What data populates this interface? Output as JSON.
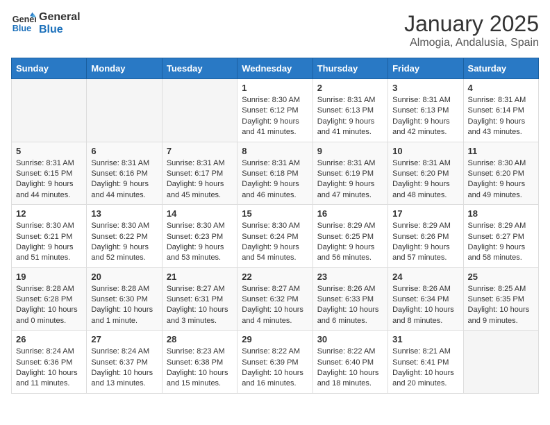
{
  "logo": {
    "line1": "General",
    "line2": "Blue"
  },
  "header": {
    "month": "January 2025",
    "location": "Almogia, Andalusia, Spain"
  },
  "weekdays": [
    "Sunday",
    "Monday",
    "Tuesday",
    "Wednesday",
    "Thursday",
    "Friday",
    "Saturday"
  ],
  "weeks": [
    [
      {
        "day": "",
        "info": ""
      },
      {
        "day": "",
        "info": ""
      },
      {
        "day": "",
        "info": ""
      },
      {
        "day": "1",
        "info": "Sunrise: 8:30 AM\nSunset: 6:12 PM\nDaylight: 9 hours and 41 minutes."
      },
      {
        "day": "2",
        "info": "Sunrise: 8:31 AM\nSunset: 6:13 PM\nDaylight: 9 hours and 41 minutes."
      },
      {
        "day": "3",
        "info": "Sunrise: 8:31 AM\nSunset: 6:13 PM\nDaylight: 9 hours and 42 minutes."
      },
      {
        "day": "4",
        "info": "Sunrise: 8:31 AM\nSunset: 6:14 PM\nDaylight: 9 hours and 43 minutes."
      }
    ],
    [
      {
        "day": "5",
        "info": "Sunrise: 8:31 AM\nSunset: 6:15 PM\nDaylight: 9 hours and 44 minutes."
      },
      {
        "day": "6",
        "info": "Sunrise: 8:31 AM\nSunset: 6:16 PM\nDaylight: 9 hours and 44 minutes."
      },
      {
        "day": "7",
        "info": "Sunrise: 8:31 AM\nSunset: 6:17 PM\nDaylight: 9 hours and 45 minutes."
      },
      {
        "day": "8",
        "info": "Sunrise: 8:31 AM\nSunset: 6:18 PM\nDaylight: 9 hours and 46 minutes."
      },
      {
        "day": "9",
        "info": "Sunrise: 8:31 AM\nSunset: 6:19 PM\nDaylight: 9 hours and 47 minutes."
      },
      {
        "day": "10",
        "info": "Sunrise: 8:31 AM\nSunset: 6:20 PM\nDaylight: 9 hours and 48 minutes."
      },
      {
        "day": "11",
        "info": "Sunrise: 8:30 AM\nSunset: 6:20 PM\nDaylight: 9 hours and 49 minutes."
      }
    ],
    [
      {
        "day": "12",
        "info": "Sunrise: 8:30 AM\nSunset: 6:21 PM\nDaylight: 9 hours and 51 minutes."
      },
      {
        "day": "13",
        "info": "Sunrise: 8:30 AM\nSunset: 6:22 PM\nDaylight: 9 hours and 52 minutes."
      },
      {
        "day": "14",
        "info": "Sunrise: 8:30 AM\nSunset: 6:23 PM\nDaylight: 9 hours and 53 minutes."
      },
      {
        "day": "15",
        "info": "Sunrise: 8:30 AM\nSunset: 6:24 PM\nDaylight: 9 hours and 54 minutes."
      },
      {
        "day": "16",
        "info": "Sunrise: 8:29 AM\nSunset: 6:25 PM\nDaylight: 9 hours and 56 minutes."
      },
      {
        "day": "17",
        "info": "Sunrise: 8:29 AM\nSunset: 6:26 PM\nDaylight: 9 hours and 57 minutes."
      },
      {
        "day": "18",
        "info": "Sunrise: 8:29 AM\nSunset: 6:27 PM\nDaylight: 9 hours and 58 minutes."
      }
    ],
    [
      {
        "day": "19",
        "info": "Sunrise: 8:28 AM\nSunset: 6:28 PM\nDaylight: 10 hours and 0 minutes."
      },
      {
        "day": "20",
        "info": "Sunrise: 8:28 AM\nSunset: 6:30 PM\nDaylight: 10 hours and 1 minute."
      },
      {
        "day": "21",
        "info": "Sunrise: 8:27 AM\nSunset: 6:31 PM\nDaylight: 10 hours and 3 minutes."
      },
      {
        "day": "22",
        "info": "Sunrise: 8:27 AM\nSunset: 6:32 PM\nDaylight: 10 hours and 4 minutes."
      },
      {
        "day": "23",
        "info": "Sunrise: 8:26 AM\nSunset: 6:33 PM\nDaylight: 10 hours and 6 minutes."
      },
      {
        "day": "24",
        "info": "Sunrise: 8:26 AM\nSunset: 6:34 PM\nDaylight: 10 hours and 8 minutes."
      },
      {
        "day": "25",
        "info": "Sunrise: 8:25 AM\nSunset: 6:35 PM\nDaylight: 10 hours and 9 minutes."
      }
    ],
    [
      {
        "day": "26",
        "info": "Sunrise: 8:24 AM\nSunset: 6:36 PM\nDaylight: 10 hours and 11 minutes."
      },
      {
        "day": "27",
        "info": "Sunrise: 8:24 AM\nSunset: 6:37 PM\nDaylight: 10 hours and 13 minutes."
      },
      {
        "day": "28",
        "info": "Sunrise: 8:23 AM\nSunset: 6:38 PM\nDaylight: 10 hours and 15 minutes."
      },
      {
        "day": "29",
        "info": "Sunrise: 8:22 AM\nSunset: 6:39 PM\nDaylight: 10 hours and 16 minutes."
      },
      {
        "day": "30",
        "info": "Sunrise: 8:22 AM\nSunset: 6:40 PM\nDaylight: 10 hours and 18 minutes."
      },
      {
        "day": "31",
        "info": "Sunrise: 8:21 AM\nSunset: 6:41 PM\nDaylight: 10 hours and 20 minutes."
      },
      {
        "day": "",
        "info": ""
      }
    ]
  ]
}
